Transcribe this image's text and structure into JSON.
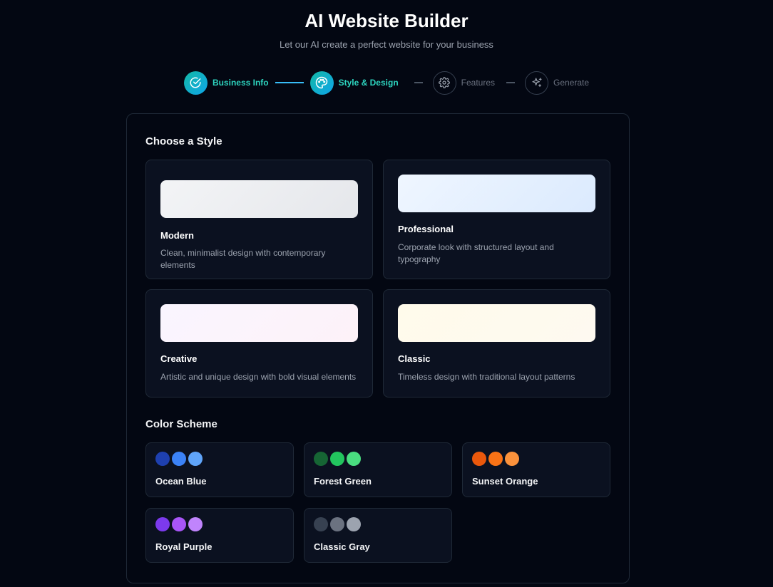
{
  "header": {
    "title": "AI Website Builder",
    "subtitle": "Let our AI create a perfect website for your business"
  },
  "steps": [
    {
      "label": "Business Info",
      "icon": "check-circle-icon",
      "state": "completed"
    },
    {
      "label": "Style & Design",
      "icon": "palette-icon",
      "state": "active"
    },
    {
      "label": "Features",
      "icon": "gear-icon",
      "state": "pending"
    },
    {
      "label": "Generate",
      "icon": "sparkles-icon",
      "state": "pending"
    }
  ],
  "style_section": {
    "title": "Choose a Style",
    "styles": [
      {
        "name": "Modern",
        "description": "Clean, minimalist design with contemporary elements",
        "preview_colors": [
          "#f3f4f6",
          "#e5e7eb"
        ]
      },
      {
        "name": "Professional",
        "description": "Corporate look with structured layout and typography",
        "preview_colors": [
          "#eff6ff",
          "#dbeafe"
        ]
      },
      {
        "name": "Creative",
        "description": "Artistic and unique design with bold visual elements",
        "preview_colors": [
          "#faf5ff",
          "#fdf2f8"
        ]
      },
      {
        "name": "Classic",
        "description": "Timeless design with traditional layout patterns",
        "preview_colors": [
          "#fffbeb",
          "#fef9f0"
        ]
      }
    ]
  },
  "color_section": {
    "title": "Color Scheme",
    "schemes": [
      {
        "name": "Ocean Blue",
        "colors": [
          "#1e40af",
          "#3b82f6",
          "#60a5fa"
        ]
      },
      {
        "name": "Forest Green",
        "colors": [
          "#166534",
          "#22c55e",
          "#4ade80"
        ]
      },
      {
        "name": "Sunset Orange",
        "colors": [
          "#ea580c",
          "#f97316",
          "#fb923c"
        ]
      },
      {
        "name": "Royal Purple",
        "colors": [
          "#7c3aed",
          "#a855f7",
          "#c084fc"
        ]
      },
      {
        "name": "Classic Gray",
        "colors": [
          "#374151",
          "#6b7280",
          "#9ca3af"
        ]
      }
    ]
  },
  "colors": {
    "accent": "#2dd4bf",
    "background": "#030712",
    "card": "#0b1120",
    "border": "#1f2937"
  }
}
